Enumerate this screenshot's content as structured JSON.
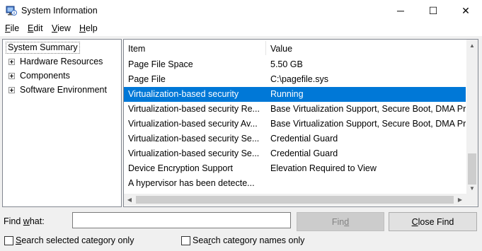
{
  "window": {
    "title": "System Information",
    "minimize_glyph": "─",
    "maximize_glyph": "☐",
    "close_glyph": "✕"
  },
  "menu": {
    "items": [
      {
        "u": "F",
        "rest": "ile"
      },
      {
        "u": "E",
        "rest": "dit"
      },
      {
        "u": "V",
        "rest": "iew"
      },
      {
        "u": "H",
        "rest": "elp"
      }
    ]
  },
  "tree": {
    "root": "System Summary",
    "nodes": [
      "Hardware Resources",
      "Components",
      "Software Environment"
    ]
  },
  "list": {
    "headers": {
      "item": "Item",
      "value": "Value"
    },
    "rows": [
      {
        "item": "Page File Space",
        "value": "5.50 GB"
      },
      {
        "item": "Page File",
        "value": "C:\\pagefile.sys"
      },
      {
        "item": "Virtualization-based security",
        "value": "Running"
      },
      {
        "item": "Virtualization-based security Re...",
        "value": "Base Virtualization Support, Secure Boot, DMA Pr"
      },
      {
        "item": "Virtualization-based security Av...",
        "value": "Base Virtualization Support, Secure Boot, DMA Pr"
      },
      {
        "item": "Virtualization-based security Se...",
        "value": "Credential Guard"
      },
      {
        "item": "Virtualization-based security Se...",
        "value": "Credential Guard"
      },
      {
        "item": "Device Encryption Support",
        "value": "Elevation Required to View"
      },
      {
        "item": "A hypervisor has been detecte...",
        "value": ""
      }
    ],
    "selected_index": 2
  },
  "find": {
    "label_pre": "Find ",
    "label_u": "w",
    "label_post": "hat:",
    "input_value": "",
    "find_button": {
      "u": "",
      "pre": "Fin",
      "ul": "d"
    },
    "close_button": {
      "u": "C",
      "rest": "lose Find"
    },
    "check_selected": {
      "u": "S",
      "rest": "earch selected category only"
    },
    "check_names": {
      "pre": "Sea",
      "u": "r",
      "rest": "ch category names only"
    }
  },
  "colors": {
    "selection": "#0078d7",
    "window_bg": "#f0f0f0"
  }
}
